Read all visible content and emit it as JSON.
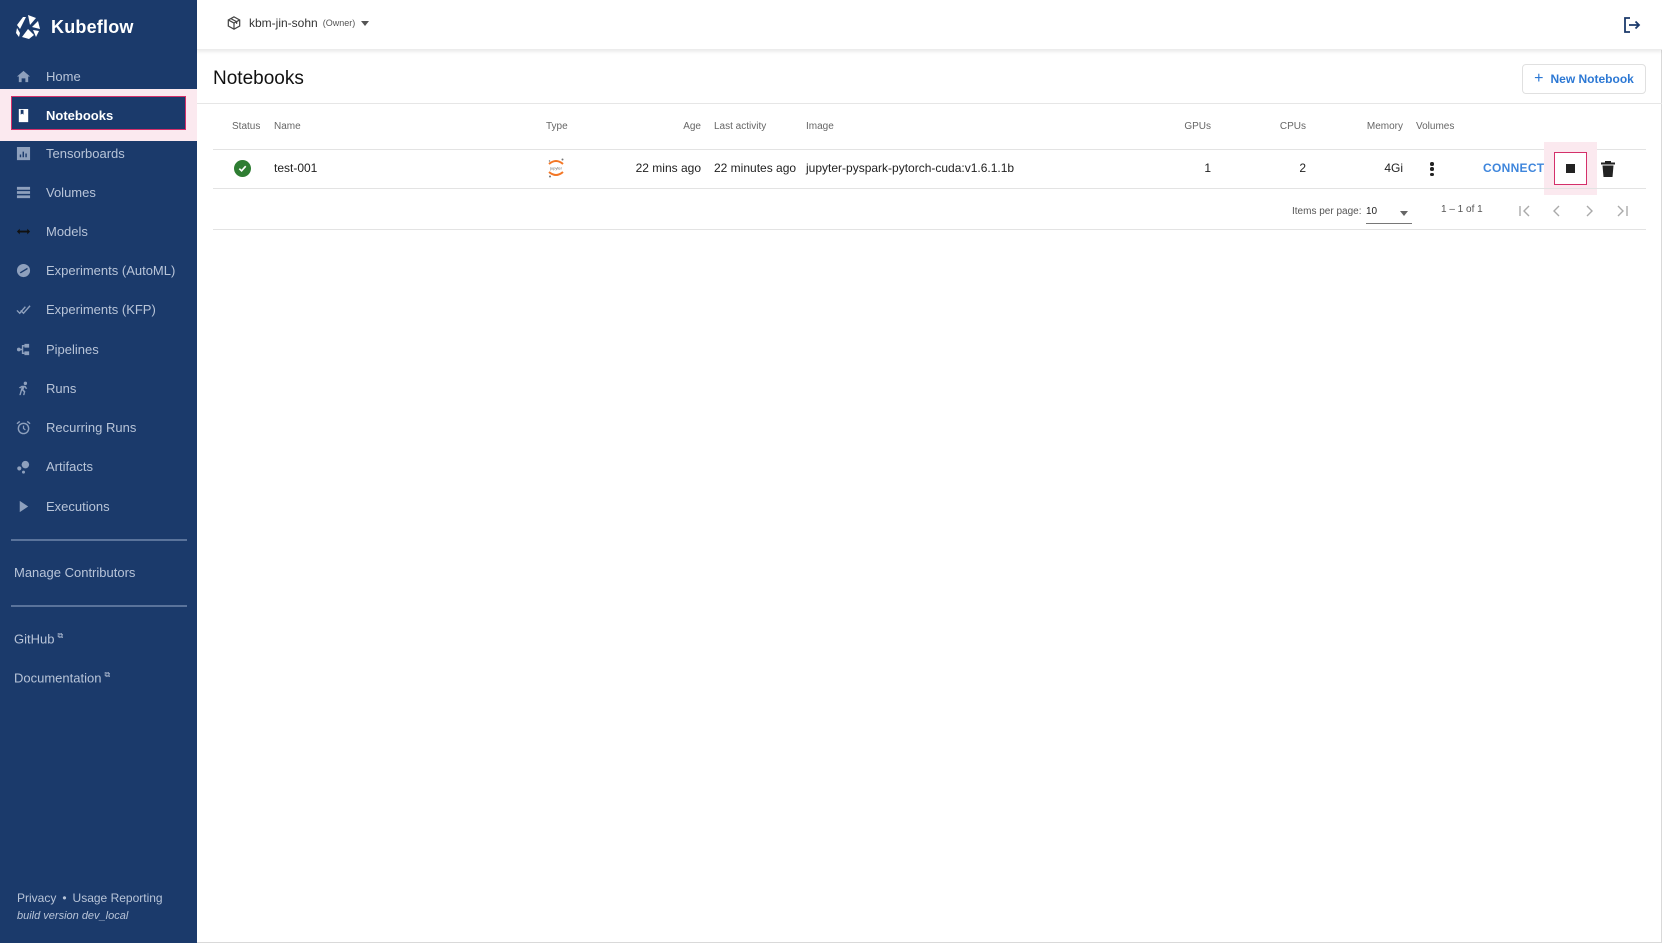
{
  "app": {
    "name": "Kubeflow"
  },
  "sidebar": {
    "items": [
      {
        "label": "Home",
        "icon": "home-icon"
      },
      {
        "label": "Notebooks",
        "icon": "notebook-icon",
        "active": true
      },
      {
        "label": "Tensorboards",
        "icon": "bar-chart-icon"
      },
      {
        "label": "Volumes",
        "icon": "storage-icon"
      },
      {
        "label": "Models",
        "icon": "code-arrows-icon"
      },
      {
        "label": "Experiments (AutoML)",
        "icon": "telescope-icon"
      },
      {
        "label": "Experiments (KFP)",
        "icon": "double-check-icon"
      },
      {
        "label": "Pipelines",
        "icon": "pipeline-icon"
      },
      {
        "label": "Runs",
        "icon": "running-person-icon"
      },
      {
        "label": "Recurring Runs",
        "icon": "alarm-clock-icon"
      },
      {
        "label": "Artifacts",
        "icon": "bubbles-icon"
      },
      {
        "label": "Executions",
        "icon": "play-icon"
      }
    ],
    "manage_contributors": "Manage Contributors",
    "github": "GitHub",
    "documentation": "Documentation",
    "privacy": "Privacy",
    "dot": "•",
    "usage_reporting": "Usage Reporting",
    "build_version": "build version dev_local"
  },
  "header": {
    "namespace": "kbm-jin-sohn",
    "role": "(Owner)"
  },
  "page": {
    "title": "Notebooks",
    "new_button": "New Notebook",
    "new_button_icon": "+"
  },
  "table": {
    "columns": [
      "Status",
      "Name",
      "Type",
      "Age",
      "Last activity",
      "Image",
      "GPUs",
      "CPUs",
      "Memory",
      "Volumes"
    ],
    "rows": [
      {
        "status": "running",
        "name": "test-001",
        "type": "jupyter",
        "age": "22 mins ago",
        "last_activity": "22 minutes ago",
        "image": "jupyter-pyspark-pytorch-cuda:v1.6.1.1b",
        "gpus": "1",
        "cpus": "2",
        "memory": "4Gi",
        "connect_label": "CONNECT"
      }
    ]
  },
  "paginator": {
    "items_per_page_label": "Items per page:",
    "items_per_page": "10",
    "range": "1 – 1 of 1"
  },
  "colors": {
    "sidebar_bg": "#1b3a6b",
    "accent": "#2c78d4",
    "highlight": "#d4306a",
    "status_ok": "#2e7d32"
  }
}
